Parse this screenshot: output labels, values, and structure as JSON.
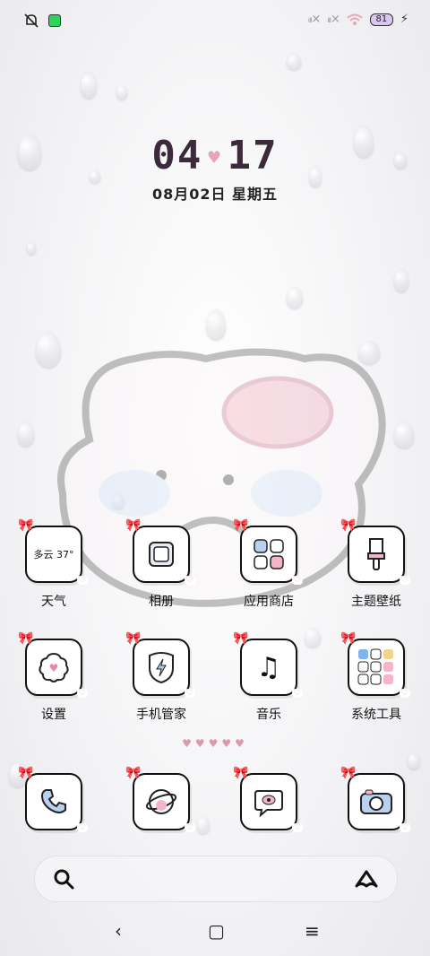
{
  "status_bar": {
    "left_icons": [
      "notification-off-icon",
      "app-indicator-icon"
    ],
    "signal_1": "ᵢₗₗ×",
    "signal_2": "ᵢₗₗ×",
    "wifi_icon": "wifi-icon",
    "battery_level": "81",
    "charging_icon": "⚡"
  },
  "clock": {
    "hours": "04",
    "minutes": "17",
    "separator": "♥",
    "date": "08月02日 星期五"
  },
  "apps_row1": [
    {
      "label": "天气",
      "icon": "weather-icon",
      "icon_text": "多云 37°"
    },
    {
      "label": "相册",
      "icon": "gallery-icon"
    },
    {
      "label": "应用商店",
      "icon": "app-store-icon"
    },
    {
      "label": "主题壁纸",
      "icon": "themes-icon"
    }
  ],
  "apps_row2": [
    {
      "label": "设置",
      "icon": "settings-icon"
    },
    {
      "label": "手机管家",
      "icon": "security-icon"
    },
    {
      "label": "音乐",
      "icon": "music-icon"
    },
    {
      "label": "系统工具",
      "icon": "system-tools-folder-icon"
    }
  ],
  "page_indicator": "♥♥♥♥♥",
  "dock": [
    {
      "icon": "phone-icon"
    },
    {
      "icon": "browser-icon"
    },
    {
      "icon": "messages-icon"
    },
    {
      "icon": "camera-icon"
    }
  ],
  "search_bar": {
    "left_icon": "search-icon",
    "right_icon": "assistant-icon"
  },
  "nav_bar": {
    "back": "‹",
    "home": "▢",
    "recents": "≡"
  }
}
